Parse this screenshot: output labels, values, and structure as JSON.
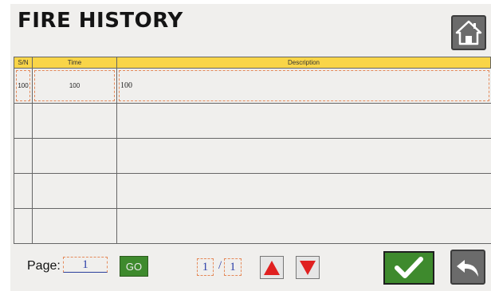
{
  "title": "FIRE HISTORY",
  "table": {
    "headers": [
      "S/N",
      "Time",
      "Description"
    ],
    "rows": [
      {
        "sn": "100",
        "time": "100",
        "description": "100"
      },
      {
        "sn": "",
        "time": "",
        "description": ""
      },
      {
        "sn": "",
        "time": "",
        "description": ""
      },
      {
        "sn": "",
        "time": "",
        "description": ""
      },
      {
        "sn": "",
        "time": "",
        "description": ""
      }
    ]
  },
  "pagination": {
    "page_label": "Page:",
    "page_input": "1",
    "go_label": "GO",
    "current_page": "1",
    "separator": "/",
    "total_pages": "1"
  },
  "icons": {
    "home": "home-icon",
    "up": "up-arrow-icon",
    "down": "down-arrow-icon",
    "confirm": "checkmark-icon",
    "back": "return-icon"
  },
  "colors": {
    "header_bg": "#f9d548",
    "button_green": "#3e8a2d",
    "arrow_red": "#e02020",
    "dashed_orange": "#e58a5a"
  }
}
